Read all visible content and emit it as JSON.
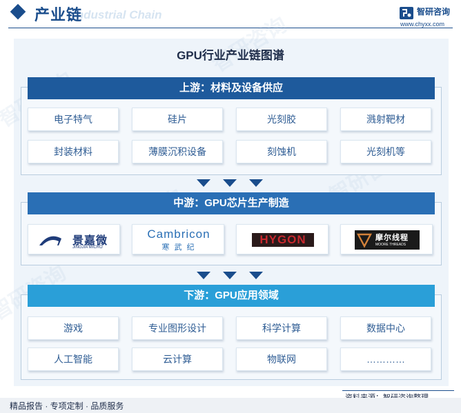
{
  "header": {
    "title": "产业链",
    "title_en": "Industrial Chain",
    "brand_name": "智研咨询",
    "brand_url": "www.chyxx.com"
  },
  "watermark": "智研咨询",
  "diagram_title": "GPU行业产业链图谱",
  "upstream": {
    "label": "上游：材料及设备供应",
    "items": [
      "电子特气",
      "硅片",
      "光刻胶",
      "溅射靶材",
      "封装材料",
      "薄膜沉积设备",
      "刻蚀机",
      "光刻机等"
    ]
  },
  "midstream": {
    "label": "中游：GPU芯片生产制造",
    "companies": [
      {
        "cn": "景嘉微",
        "en": "JINGJIA MICRO"
      },
      {
        "name": "Cambricon",
        "cn": "寒 武 纪"
      },
      {
        "name": "HYGON"
      },
      {
        "cn": "摩尔线程",
        "en": "MOORE THREADS"
      }
    ]
  },
  "downstream": {
    "label": "下游：GPU应用领域",
    "items": [
      "游戏",
      "专业图形设计",
      "科学计算",
      "数据中心",
      "人工智能",
      "云计算",
      "物联网",
      "…………"
    ]
  },
  "footer": {
    "source": "资料来源：智研咨询整理",
    "slogan": "精品报告 · 专项定制 · 品质服务"
  },
  "colors": {
    "primary": "#1a4d8c",
    "upstream_bar": "#1e5a9c",
    "midstream_bar": "#2a6fb5",
    "downstream_bar": "#2a9fd8",
    "cell_text": "#2f5d94",
    "hygon_red": "#c8272d"
  }
}
